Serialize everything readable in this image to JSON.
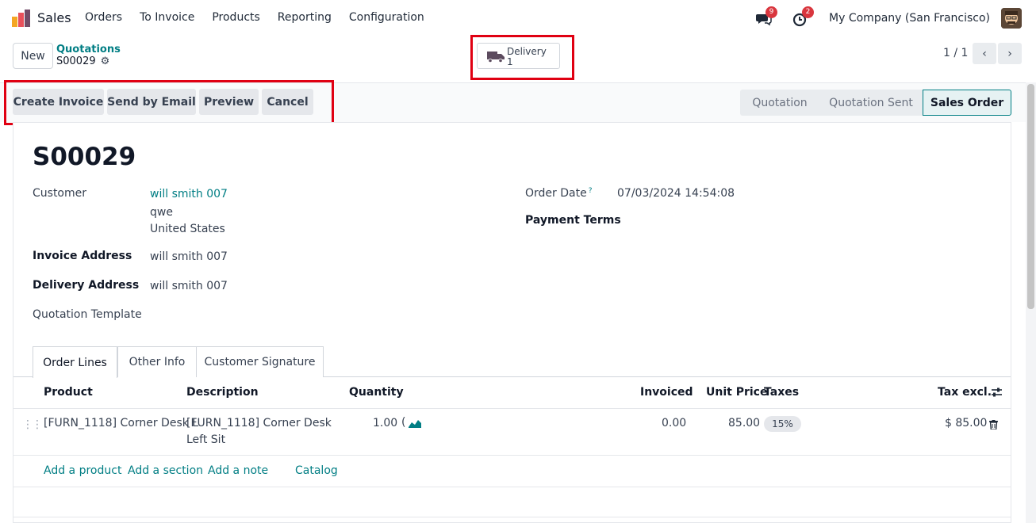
{
  "nav": {
    "app_name": "Sales",
    "menu": [
      "Orders",
      "To Invoice",
      "Products",
      "Reporting",
      "Configuration"
    ],
    "messages_badge": "9",
    "activities_badge": "2",
    "company": "My Company (San Francisco)"
  },
  "control": {
    "new_label": "New",
    "breadcrumb_parent": "Quotations",
    "breadcrumb_current": "S00029",
    "smart_button": {
      "label": "Delivery",
      "count": "1",
      "icon": "truck-icon"
    },
    "pager": "1 / 1"
  },
  "actions": [
    "Create Invoice",
    "Send by Email",
    "Preview",
    "Cancel"
  ],
  "stages": [
    {
      "label": "Quotation",
      "active": false
    },
    {
      "label": "Quotation Sent",
      "active": false
    },
    {
      "label": "Sales Order",
      "active": true
    }
  ],
  "form": {
    "title": "S00029",
    "customer_label": "Customer",
    "customer_name": "will smith 007",
    "customer_line2": "qwe",
    "customer_line3": "United States",
    "invoice_address_label": "Invoice Address",
    "invoice_address": "will smith 007",
    "delivery_address_label": "Delivery Address",
    "delivery_address": "will smith 007",
    "quotation_template_label": "Quotation Template",
    "order_date_label": "Order Date",
    "order_date_help": "?",
    "order_date": "07/03/2024 14:54:08",
    "payment_terms_label": "Payment Terms"
  },
  "tabs": [
    "Order Lines",
    "Other Info",
    "Customer Signature"
  ],
  "table": {
    "headers": [
      "Product",
      "Description",
      "Quantity",
      "Invoiced",
      "Unit Price",
      "Taxes",
      "Tax excl."
    ],
    "rows": [
      {
        "product": "[FURN_1118] Corner Desk L",
        "description_1": "[FURN_1118] Corner Desk",
        "description_2": "Left Sit",
        "quantity": "1.00",
        "invoiced": "0.00",
        "unit_price": "85.00",
        "taxes": "15%",
        "subtotal": "$ 85.00"
      }
    ],
    "add_links": [
      "Add a product",
      "Add a section",
      "Add a note",
      "Catalog"
    ]
  },
  "colors": {
    "accent": "#017e84",
    "highlight_box": "#e00012"
  }
}
